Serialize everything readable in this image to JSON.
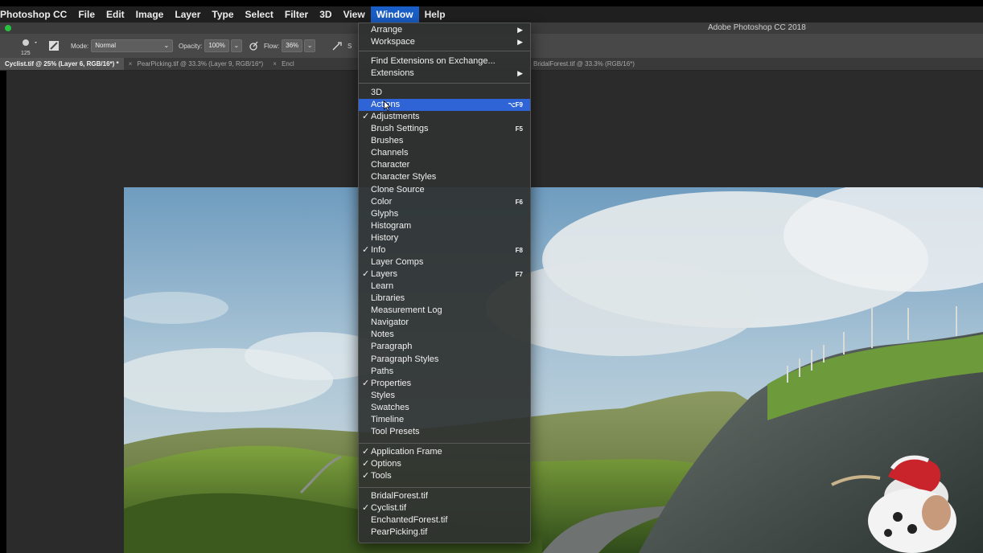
{
  "menubar": {
    "app_name": "Photoshop CC",
    "items": [
      "File",
      "Edit",
      "Image",
      "Layer",
      "Type",
      "Select",
      "Filter",
      "3D",
      "View",
      "Window",
      "Help"
    ],
    "active_item": "Window"
  },
  "window": {
    "title": "Adobe Photoshop CC 2018"
  },
  "options_bar": {
    "brush_size": "125",
    "mode_label": "Mode:",
    "mode_value": "Normal",
    "opacity_label": "Opacity:",
    "opacity_value": "100%",
    "flow_label": "Flow:",
    "flow_value": "36%",
    "trailing_label": "S"
  },
  "tabs": [
    {
      "label": "Cyclist.tif @ 25% (Layer 6, RGB/16*) *",
      "active": true
    },
    {
      "label": "PearPicking.tif @ 33.3% (Layer 9, RGB/16*)",
      "active": false
    },
    {
      "label": "Encl",
      "active": false
    },
    {
      "label": "BridalForest.tif @ 33.3% (RGB/16*)",
      "active": false
    }
  ],
  "window_menu": {
    "group_arrange": [
      {
        "label": "Arrange",
        "submenu": true
      },
      {
        "label": "Workspace",
        "submenu": true
      }
    ],
    "group_extensions": [
      {
        "label": "Find Extensions on Exchange...",
        "submenu": false
      },
      {
        "label": "Extensions",
        "submenu": true
      }
    ],
    "group_panels": [
      {
        "label": "3D",
        "checked": false,
        "shortcut": ""
      },
      {
        "label": "Actions",
        "checked": false,
        "shortcut": "⌥F9",
        "highlighted": true
      },
      {
        "label": "Adjustments",
        "checked": true,
        "shortcut": ""
      },
      {
        "label": "Brush Settings",
        "checked": false,
        "shortcut": "F5"
      },
      {
        "label": "Brushes",
        "checked": false,
        "shortcut": ""
      },
      {
        "label": "Channels",
        "checked": false,
        "shortcut": ""
      },
      {
        "label": "Character",
        "checked": false,
        "shortcut": ""
      },
      {
        "label": "Character Styles",
        "checked": false,
        "shortcut": ""
      },
      {
        "label": "Clone Source",
        "checked": false,
        "shortcut": ""
      },
      {
        "label": "Color",
        "checked": false,
        "shortcut": "F6"
      },
      {
        "label": "Glyphs",
        "checked": false,
        "shortcut": ""
      },
      {
        "label": "Histogram",
        "checked": false,
        "shortcut": ""
      },
      {
        "label": "History",
        "checked": false,
        "shortcut": ""
      },
      {
        "label": "Info",
        "checked": true,
        "shortcut": "F8"
      },
      {
        "label": "Layer Comps",
        "checked": false,
        "shortcut": ""
      },
      {
        "label": "Layers",
        "checked": true,
        "shortcut": "F7"
      },
      {
        "label": "Learn",
        "checked": false,
        "shortcut": ""
      },
      {
        "label": "Libraries",
        "checked": false,
        "shortcut": ""
      },
      {
        "label": "Measurement Log",
        "checked": false,
        "shortcut": ""
      },
      {
        "label": "Navigator",
        "checked": false,
        "shortcut": ""
      },
      {
        "label": "Notes",
        "checked": false,
        "shortcut": ""
      },
      {
        "label": "Paragraph",
        "checked": false,
        "shortcut": ""
      },
      {
        "label": "Paragraph Styles",
        "checked": false,
        "shortcut": ""
      },
      {
        "label": "Paths",
        "checked": false,
        "shortcut": ""
      },
      {
        "label": "Properties",
        "checked": true,
        "shortcut": ""
      },
      {
        "label": "Styles",
        "checked": false,
        "shortcut": ""
      },
      {
        "label": "Swatches",
        "checked": false,
        "shortcut": ""
      },
      {
        "label": "Timeline",
        "checked": false,
        "shortcut": ""
      },
      {
        "label": "Tool Presets",
        "checked": false,
        "shortcut": ""
      }
    ],
    "group_frame": [
      {
        "label": "Application Frame",
        "checked": true
      },
      {
        "label": "Options",
        "checked": true
      },
      {
        "label": "Tools",
        "checked": true
      }
    ],
    "group_documents": [
      {
        "label": "BridalForest.tif",
        "checked": false
      },
      {
        "label": "Cyclist.tif",
        "checked": true
      },
      {
        "label": "EnchantedForest.tif",
        "checked": false
      },
      {
        "label": "PearPicking.tif",
        "checked": false
      }
    ]
  },
  "icons": {
    "submenu": "chevron-right-icon",
    "check": "checkmark-icon",
    "brush": "brush-preset-icon",
    "airbrush": "airbrush-icon",
    "cursor": "mouse-pointer-icon"
  },
  "colors": {
    "menu_highlight": "#2f64d6",
    "menubar_active": "#1a5fc8",
    "workspace": "#2b2b2b"
  }
}
